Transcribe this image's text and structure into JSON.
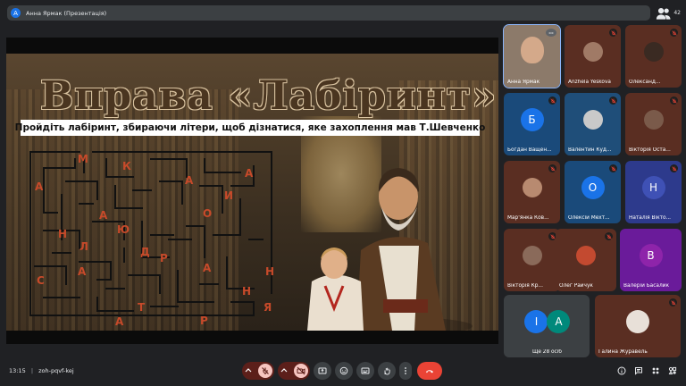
{
  "top_bar": {
    "avatar_letter": "A",
    "title": "Анна Ярмак (Презентація)",
    "people_count": "42"
  },
  "slide": {
    "title": "Вправа «Лабіринт»",
    "subtitle": "Пройдіть лабіринт, збираючи літери, щоб дізнатися, яке захоплення мав Т.Шевченко",
    "maze_letters": [
      "М",
      "К",
      "А",
      "А",
      "А",
      "И",
      "О",
      "А",
      "Н",
      "Ю",
      "Л",
      "Д",
      "С",
      "Р",
      "А",
      "А",
      "Н",
      "Т",
      "Н",
      "Я",
      "А",
      "Р"
    ]
  },
  "participants": [
    {
      "name": "Анна Ярмак",
      "type": "video",
      "bg": "#8c7a6a",
      "active": true
    },
    {
      "name": "Anzhela Yeskova",
      "type": "photo",
      "bg": "#5a2e22",
      "muted": true
    },
    {
      "name": "Олександ...",
      "type": "photo",
      "bg": "#5a2e22",
      "muted": true
    },
    {
      "name": "Богдан Ващен...",
      "type": "letter",
      "letter": "Б",
      "bg": "#1a4a7a",
      "circle": "#1a73e8",
      "muted": true
    },
    {
      "name": "Валентин Куд...",
      "type": "photo",
      "bg": "#1f4e79",
      "muted": true
    },
    {
      "name": "Вікторія Оста...",
      "type": "photo",
      "bg": "#5a2e22",
      "muted": true
    },
    {
      "name": "Мар'янка Ков...",
      "type": "photo",
      "bg": "#5a2e22",
      "muted": true
    },
    {
      "name": "Олексій Мехт...",
      "type": "letter",
      "letter": "О",
      "bg": "#1a4a7a",
      "circle": "#1a73e8",
      "muted": true
    },
    {
      "name": "Наталія Вікто...",
      "type": "letter",
      "letter": "Н",
      "bg": "#2d3a8c",
      "circle": "#3f51b5",
      "muted": true
    },
    {
      "name": "Вікторія Кр...",
      "type": "photo",
      "bg": "#5a2e22",
      "muted": true
    },
    {
      "name": "Олег Райчук",
      "type": "photo",
      "bg": "#5a2e22",
      "muted": true
    },
    {
      "name": "Валерій Басалик",
      "type": "letter",
      "letter": "В",
      "bg": "#6a1b9a",
      "circle": "#8e24aa",
      "muted": true
    },
    {
      "name": "Ще 28 осіб",
      "type": "more",
      "letters": [
        "І",
        "А"
      ],
      "bg": "#3c4043"
    },
    {
      "name": "Галина Журавель",
      "type": "photo",
      "bg": "#5a2e22",
      "muted": true
    }
  ],
  "bottom": {
    "time": "13:15",
    "separator": "|",
    "meeting_code": "zoh-pqvf-kej"
  },
  "icons": [
    "mic-off-icon",
    "camera-off-icon",
    "present-icon",
    "emoji-icon",
    "captions-icon",
    "raise-hand-icon",
    "more-icon",
    "end-call-icon",
    "info-icon",
    "chat-icon",
    "people-icon",
    "activities-icon"
  ],
  "colors": {
    "accent": "#1a73e8",
    "danger": "#ea4335",
    "muted_bg": "#f6c5c0"
  }
}
